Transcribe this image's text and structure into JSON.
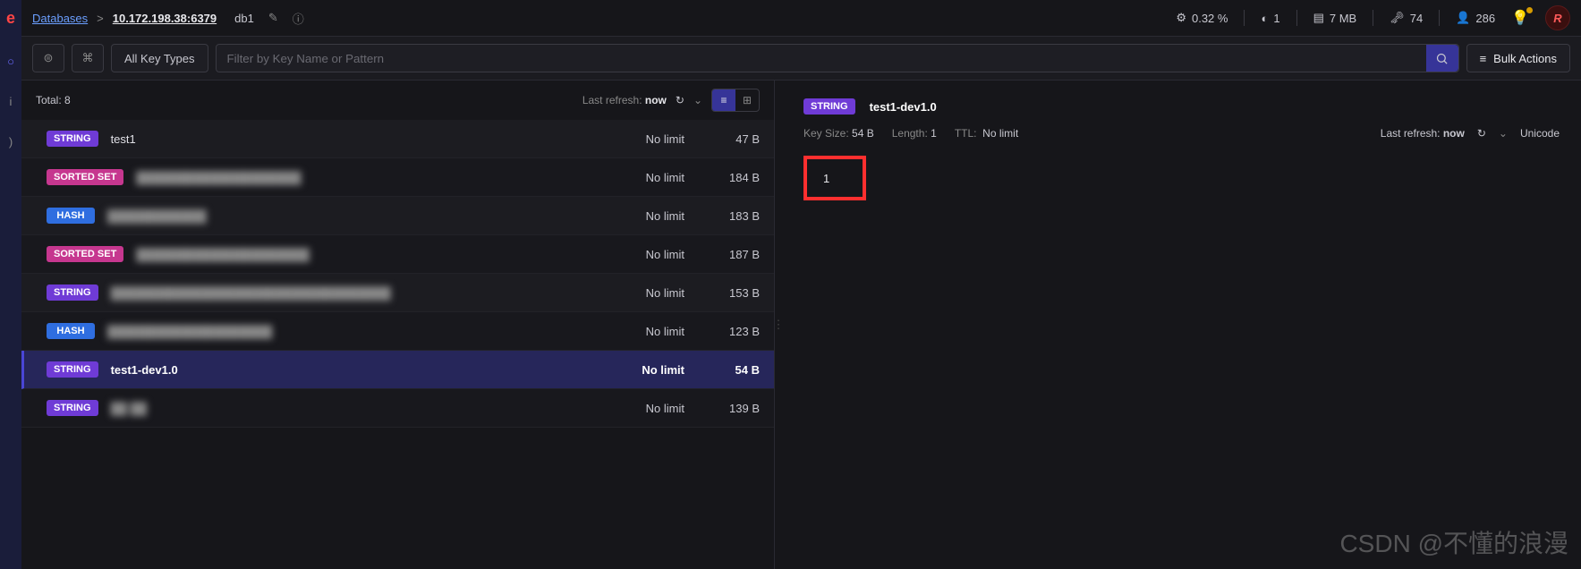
{
  "breadcrumb": {
    "root": "Databases",
    "host": "10.172.198.38:6379",
    "dbname": "db1"
  },
  "topstats": {
    "cpu": "0.32 %",
    "ops": "1",
    "memory": "7 MB",
    "keys": "74",
    "clients": "286"
  },
  "toolbar": {
    "key_type_filter": "All Key Types",
    "search_placeholder": "Filter by Key Name or Pattern",
    "bulk_label": "Bulk Actions"
  },
  "keys_header": {
    "total_label": "Total:",
    "total_value": "8",
    "last_refresh_label": "Last refresh:",
    "last_refresh_value": "now"
  },
  "keys": [
    {
      "type": "STRING",
      "name": "test1",
      "ttl": "No limit",
      "size": "47 B",
      "blurred": false,
      "selected": false
    },
    {
      "type": "SORTED SET",
      "name": "████████████████████",
      "ttl": "No limit",
      "size": "184 B",
      "blurred": true,
      "selected": false
    },
    {
      "type": "HASH",
      "name": "████████████",
      "ttl": "No limit",
      "size": "183 B",
      "blurred": true,
      "selected": false
    },
    {
      "type": "SORTED SET",
      "name": "█████████████████████",
      "ttl": "No limit",
      "size": "187 B",
      "blurred": true,
      "selected": false
    },
    {
      "type": "STRING",
      "name": "██████████████████████████████████",
      "ttl": "No limit",
      "size": "153 B",
      "blurred": true,
      "selected": false
    },
    {
      "type": "HASH",
      "name": "████████████████████",
      "ttl": "No limit",
      "size": "123 B",
      "blurred": true,
      "selected": false
    },
    {
      "type": "STRING",
      "name": "test1-dev1.0",
      "ttl": "No limit",
      "size": "54 B",
      "blurred": false,
      "selected": true,
      "boxed": true
    },
    {
      "type": "STRING",
      "name": "██ ██",
      "ttl": "No limit",
      "size": "139 B",
      "blurred": true,
      "selected": false
    }
  ],
  "detail": {
    "type": "STRING",
    "name": "test1-dev1.0",
    "key_size_label": "Key Size:",
    "key_size": "54 B",
    "length_label": "Length:",
    "length": "1",
    "ttl_label": "TTL:",
    "ttl": "No limit",
    "last_refresh_label": "Last refresh:",
    "last_refresh_value": "now",
    "encoding": "Unicode",
    "value": "1"
  },
  "watermark": "CSDN @不懂的浪漫"
}
